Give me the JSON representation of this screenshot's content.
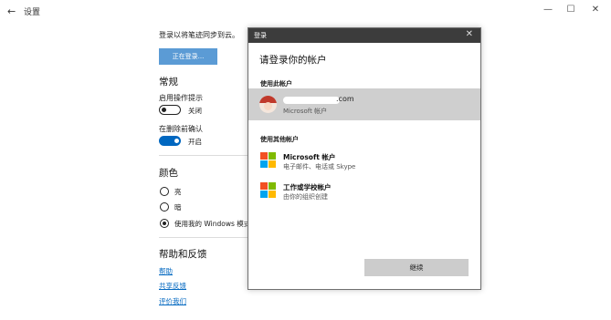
{
  "window": {
    "back": "←",
    "title": "设置",
    "minimize": "—",
    "maximize": "☐",
    "close": "✕"
  },
  "sync": {
    "label": "登录以将笔迹同步到云。",
    "button": "正在登录..."
  },
  "general": {
    "heading": "常规",
    "show_tips": "启用操作提示",
    "show_tips_state": "关闭",
    "confirm_delete": "在删除前确认",
    "confirm_delete_state": "开启"
  },
  "color": {
    "heading": "颜色",
    "options": [
      "亮",
      "暗",
      "使用我的 Windows 模式"
    ]
  },
  "help": {
    "heading": "帮助和反馈",
    "links": [
      "帮助",
      "共享反馈",
      "评价我们"
    ]
  },
  "dialog": {
    "title": "登录",
    "close": "✕",
    "heading": "请登录你的帐户",
    "this_account_label": "使用此帐户",
    "account_email_suffix": ".com",
    "account_type": "Microsoft 帐户",
    "other_account_label": "使用其他帐户",
    "options": [
      {
        "title": "Microsoft 帐户",
        "desc": "电子邮件、电话或 Skype"
      },
      {
        "title": "工作或学校帐户",
        "desc": "由你的组织创建"
      }
    ],
    "continue": "继续"
  }
}
